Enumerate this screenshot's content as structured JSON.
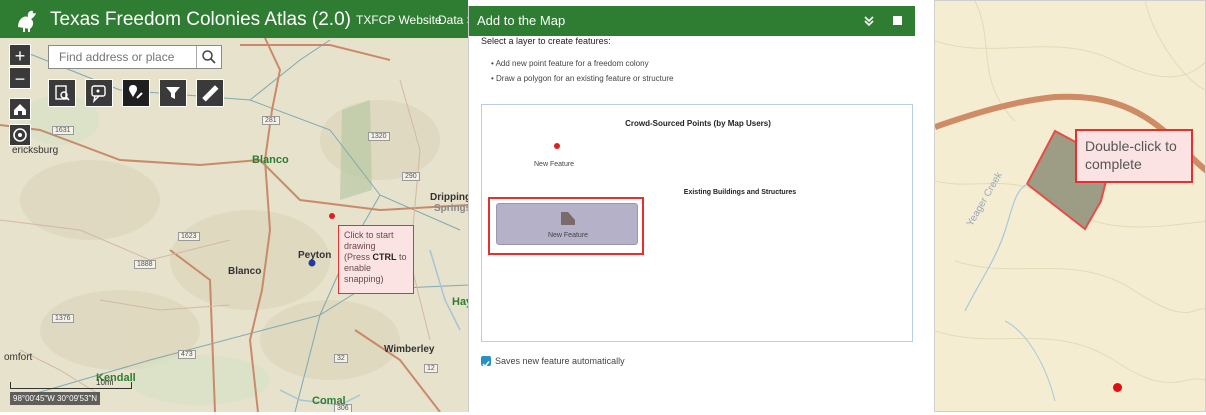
{
  "app": {
    "title": "Texas Freedom Colonies Atlas (2.0)",
    "links": [
      "TXFCP Website",
      "Data S"
    ],
    "search": {
      "placeholder": "Find address or place"
    },
    "zoom": {
      "in_label": "+",
      "out_label": "−"
    },
    "tools": [
      "identify-icon",
      "layers-icon",
      "edit-icon",
      "filter-icon",
      "measure-icon"
    ],
    "places": {
      "fredericksburg": "ericksburg",
      "blanco_north": "Blanco",
      "blanco_south": "Blanco",
      "dripping": "Dripping",
      "springs": "Springs",
      "peyton": "Peyton",
      "hays": "Hay",
      "wimberley": "Wimberley",
      "comfort": "omfort",
      "kendall": "Kendall",
      "comal": "Comal"
    },
    "shields": [
      "1631",
      "281",
      "1320",
      "290",
      "1623",
      "1888",
      "1376",
      "473",
      "32",
      "12",
      "306"
    ],
    "tooltip": {
      "line1": "Click to start",
      "line2": "drawing",
      "line3_pre": "(Press ",
      "line3_key": "CTRL",
      "line3_post": " to",
      "line4": "enable",
      "line5": "snapping)"
    },
    "coords": "98°00'45\"W 30°09'53\"N",
    "scale": "10mi"
  },
  "panel": {
    "title": "Add to the Map",
    "instruction": "Select a layer to create features:",
    "bullets": [
      "Add new point feature for a freedom colony",
      "Draw a polygon for an existing feature or structure"
    ],
    "group1": "Crowd-Sourced Points (by Map Users)",
    "group1_item": "New Feature",
    "group2": "Existing Buildings and Structures",
    "group2_item": "New Feature",
    "save_checkbox_label": "Saves new feature automatically",
    "save_checked": true
  },
  "right_map": {
    "tooltip": "Double-click to complete",
    "creek": "Yeager Creek"
  },
  "colors": {
    "header_green": "#2f7d32",
    "highlight_red": "#e53030",
    "point_red": "#e02020"
  }
}
